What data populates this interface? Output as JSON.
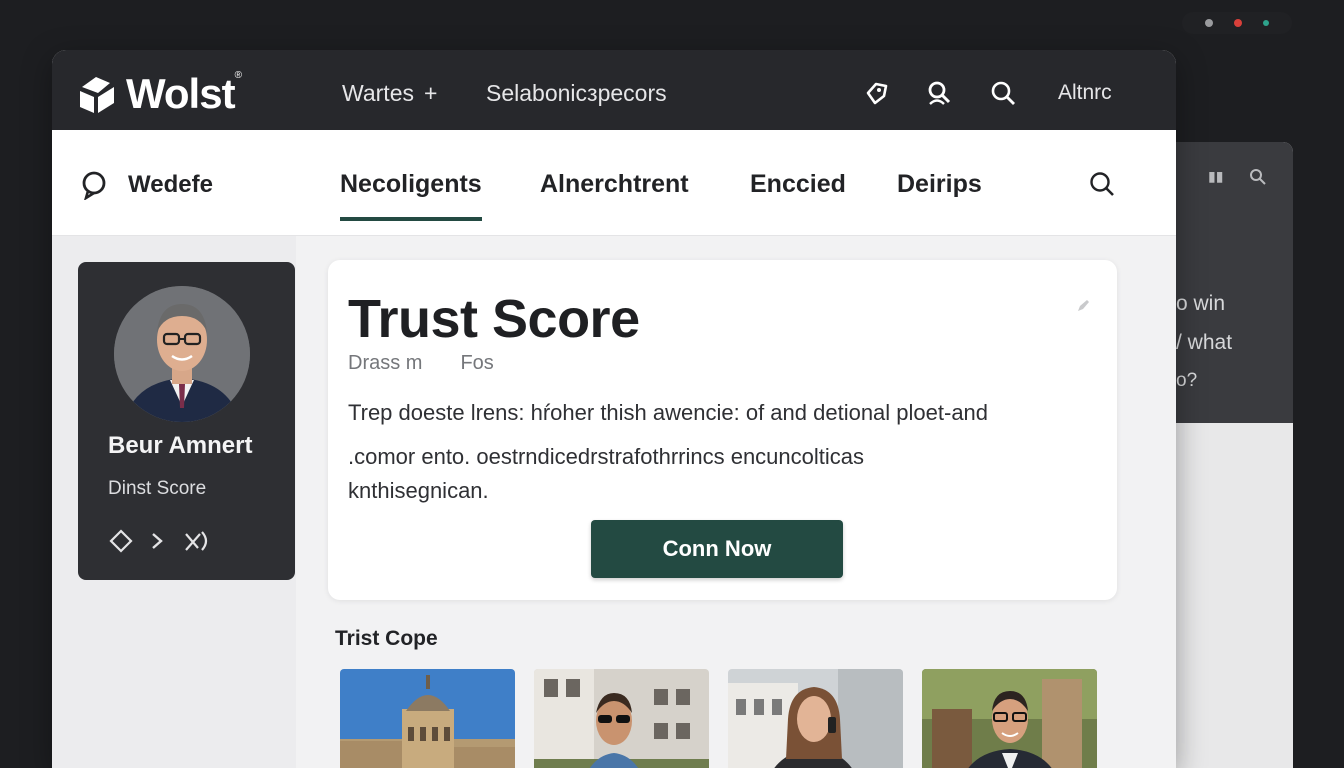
{
  "window": {
    "dots": [
      "#9a9b9e",
      "#d8403a",
      "#2ea38c"
    ]
  },
  "back_window": {
    "lines": [
      "o win",
      "/ what",
      "o?"
    ]
  },
  "topbar": {
    "logo_text": "Wolst",
    "nav_a": "Wartes",
    "nav_a_plus": "+",
    "nav_b": "Selabonicзpecors",
    "right_link": "Altnrc",
    "icons": [
      "tag-icon",
      "user-search-icon",
      "search-icon"
    ]
  },
  "subnav": {
    "brand_label": "Wedefe",
    "tabs": [
      {
        "label": "Necoligents",
        "active": true
      },
      {
        "label": "Alnerchtrent",
        "active": false
      },
      {
        "label": "Enccied",
        "active": false
      },
      {
        "label": "Deirips",
        "active": false
      }
    ]
  },
  "profile": {
    "name": "Beur Amnert",
    "subtitle": "Dinst Score",
    "actions": [
      "diamond-icon",
      "chevron-right-icon",
      "share-icon"
    ]
  },
  "score_card": {
    "title": "Trust Score",
    "meta": [
      "Drass m",
      "Fos"
    ],
    "lines": [
      "Trep doeste lrens: hŕoher thish awencie: of and detional ploet-and",
      ".comor ento. oestrndicedrstrafothrrincs encuncolticas",
      "knthisegnican."
    ],
    "button_label": "Conn Now"
  },
  "section": {
    "title": "Trist Cope"
  },
  "thumbnails": [
    {
      "subject": "domed building"
    },
    {
      "subject": "man with sunglasses"
    },
    {
      "subject": "woman on phone"
    },
    {
      "subject": "man with glasses"
    }
  ]
}
